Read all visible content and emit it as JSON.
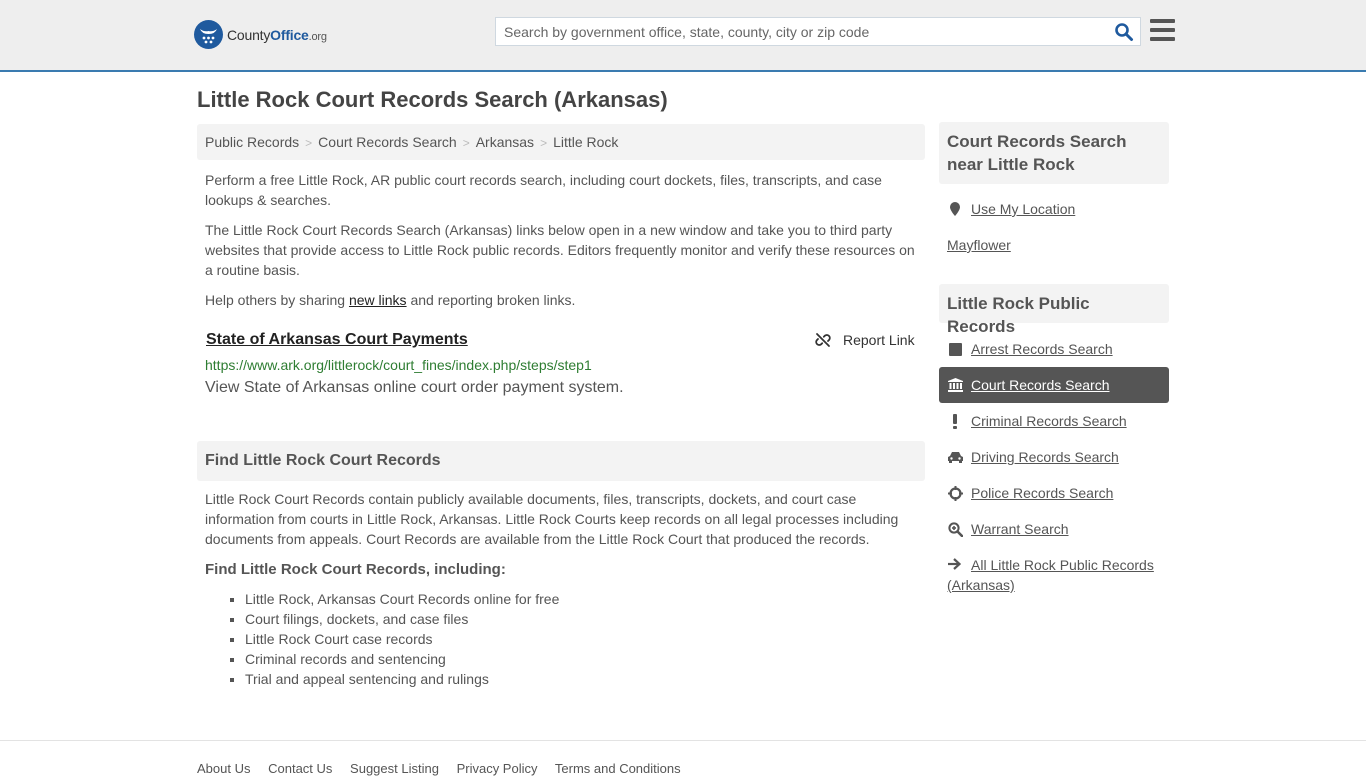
{
  "header": {
    "logo": {
      "county": "County",
      "office": "Office",
      "org": ".org"
    },
    "search_placeholder": "Search by government office, state, county, city or zip code",
    "brand_color": "#1f5a9e",
    "accent_border": "#3a7bb0"
  },
  "page_title": "Little Rock Court Records Search (Arkansas)",
  "breadcrumb": [
    "Public Records",
    "Court Records Search",
    "Arkansas",
    "Little Rock"
  ],
  "intro": {
    "p1": "Perform a free Little Rock, AR public court records search, including court dockets, files, transcripts, and case lookups & searches.",
    "p2": "The Little Rock Court Records Search (Arkansas) links below open in a new window and take you to third party websites that provide access to Little Rock public records. Editors frequently monitor and verify these resources on a routine basis.",
    "p3_before": "Help others by sharing ",
    "p3_link": "new links",
    "p3_after": " and reporting broken links."
  },
  "result": {
    "title": "State of Arkansas Court Payments",
    "report_label": "Report Link",
    "url": "https://www.ark.org/littlerock/court_fines/index.php/steps/step1",
    "description": "View State of Arkansas online court order payment system."
  },
  "find_section": {
    "heading": "Find Little Rock Court Records",
    "body": "Little Rock Court Records contain publicly available documents, files, transcripts, dockets, and court case information from courts in Little Rock, Arkansas. Little Rock Courts keep records on all legal processes including documents from appeals. Court Records are available from the Little Rock Court that produced the records.",
    "subheading": "Find Little Rock Court Records, including:",
    "bullets": [
      "Little Rock, Arkansas Court Records online for free",
      "Court filings, dockets, and case files",
      "Little Rock Court case records",
      "Criminal records and sentencing",
      "Trial and appeal sentencing and rulings"
    ]
  },
  "sidebar": {
    "near_heading": "Court Records Search near Little Rock",
    "use_location": "Use My Location",
    "nearby": [
      "Mayflower"
    ],
    "public_heading": "Little Rock Public Records",
    "items": [
      {
        "label": "Arrest Records Search",
        "icon": "square-icon",
        "active": false
      },
      {
        "label": "Court Records Search",
        "icon": "courthouse-icon",
        "active": true
      },
      {
        "label": "Criminal Records Search",
        "icon": "exclamation-icon",
        "active": false
      },
      {
        "label": "Driving Records Search",
        "icon": "car-icon",
        "active": false
      },
      {
        "label": "Police Records Search",
        "icon": "crosshair-icon",
        "active": false
      },
      {
        "label": "Warrant Search",
        "icon": "search-plus-icon",
        "active": false
      }
    ],
    "all_records": "All Little Rock Public Records (Arkansas)"
  },
  "footer": {
    "links": [
      "About Us",
      "Contact Us",
      "Suggest Listing",
      "Privacy Policy",
      "Terms and Conditions"
    ]
  }
}
